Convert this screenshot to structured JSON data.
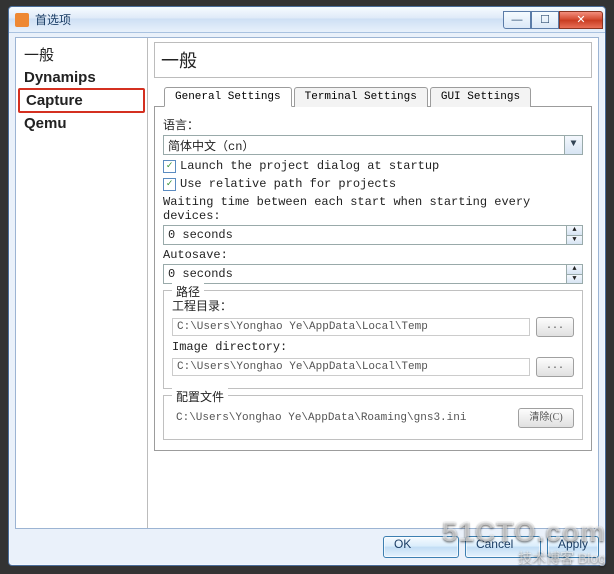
{
  "titlebar": {
    "title": "首选项"
  },
  "sidebar": {
    "items": [
      {
        "label": "一般"
      },
      {
        "label": "Dynamips"
      },
      {
        "label": "Capture"
      },
      {
        "label": "Qemu"
      }
    ]
  },
  "main": {
    "heading": "一般",
    "tabs": [
      {
        "label": "General Settings"
      },
      {
        "label": "Terminal Settings"
      },
      {
        "label": "GUI Settings"
      }
    ],
    "language_label": "语言：",
    "language_value": "简体中文（cn）",
    "checkbox1": "Launch the project dialog at startup",
    "checkbox2": "Use relative path for projects",
    "wait_label": "Waiting time between each start when starting every devices:",
    "wait_value": "0 seconds",
    "autosave_label": "Autosave:",
    "autosave_value": "0 seconds",
    "paths_group": {
      "title": "路径",
      "proj_dir_label": "工程目录：",
      "proj_dir_value": "C:\\Users\\Yonghao Ye\\AppData\\Local\\Temp",
      "img_dir_label": "Image directory:",
      "img_dir_value": "C:\\Users\\Yonghao Ye\\AppData\\Local\\Temp",
      "browse_btn": "..."
    },
    "config_group": {
      "title": "配置文件",
      "config_value": "C:\\Users\\Yonghao Ye\\AppData\\Roaming\\gns3.ini",
      "clear_btn": "清除(C)"
    }
  },
  "buttons": {
    "ok": "OK",
    "cancel": "Cancel",
    "apply": "Apply"
  },
  "watermark": {
    "line1": "51CTO.com",
    "line2": "技术博客  Blog"
  }
}
